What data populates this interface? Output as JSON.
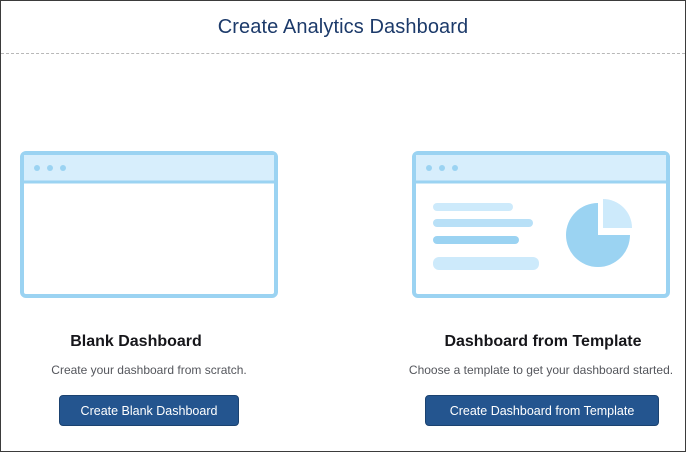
{
  "header": {
    "title": "Create Analytics Dashboard"
  },
  "options": [
    {
      "title": "Blank Dashboard",
      "description": "Create your dashboard from scratch.",
      "button_label": "Create Blank Dashboard"
    },
    {
      "title": "Dashboard from Template",
      "description": "Choose a template to get your dashboard started.",
      "button_label": "Create Dashboard from Template"
    }
  ],
  "colors": {
    "primary_button": "#24558f",
    "illustration_stroke": "#9bd3f2",
    "illustration_fill_light": "#d7eefc"
  }
}
